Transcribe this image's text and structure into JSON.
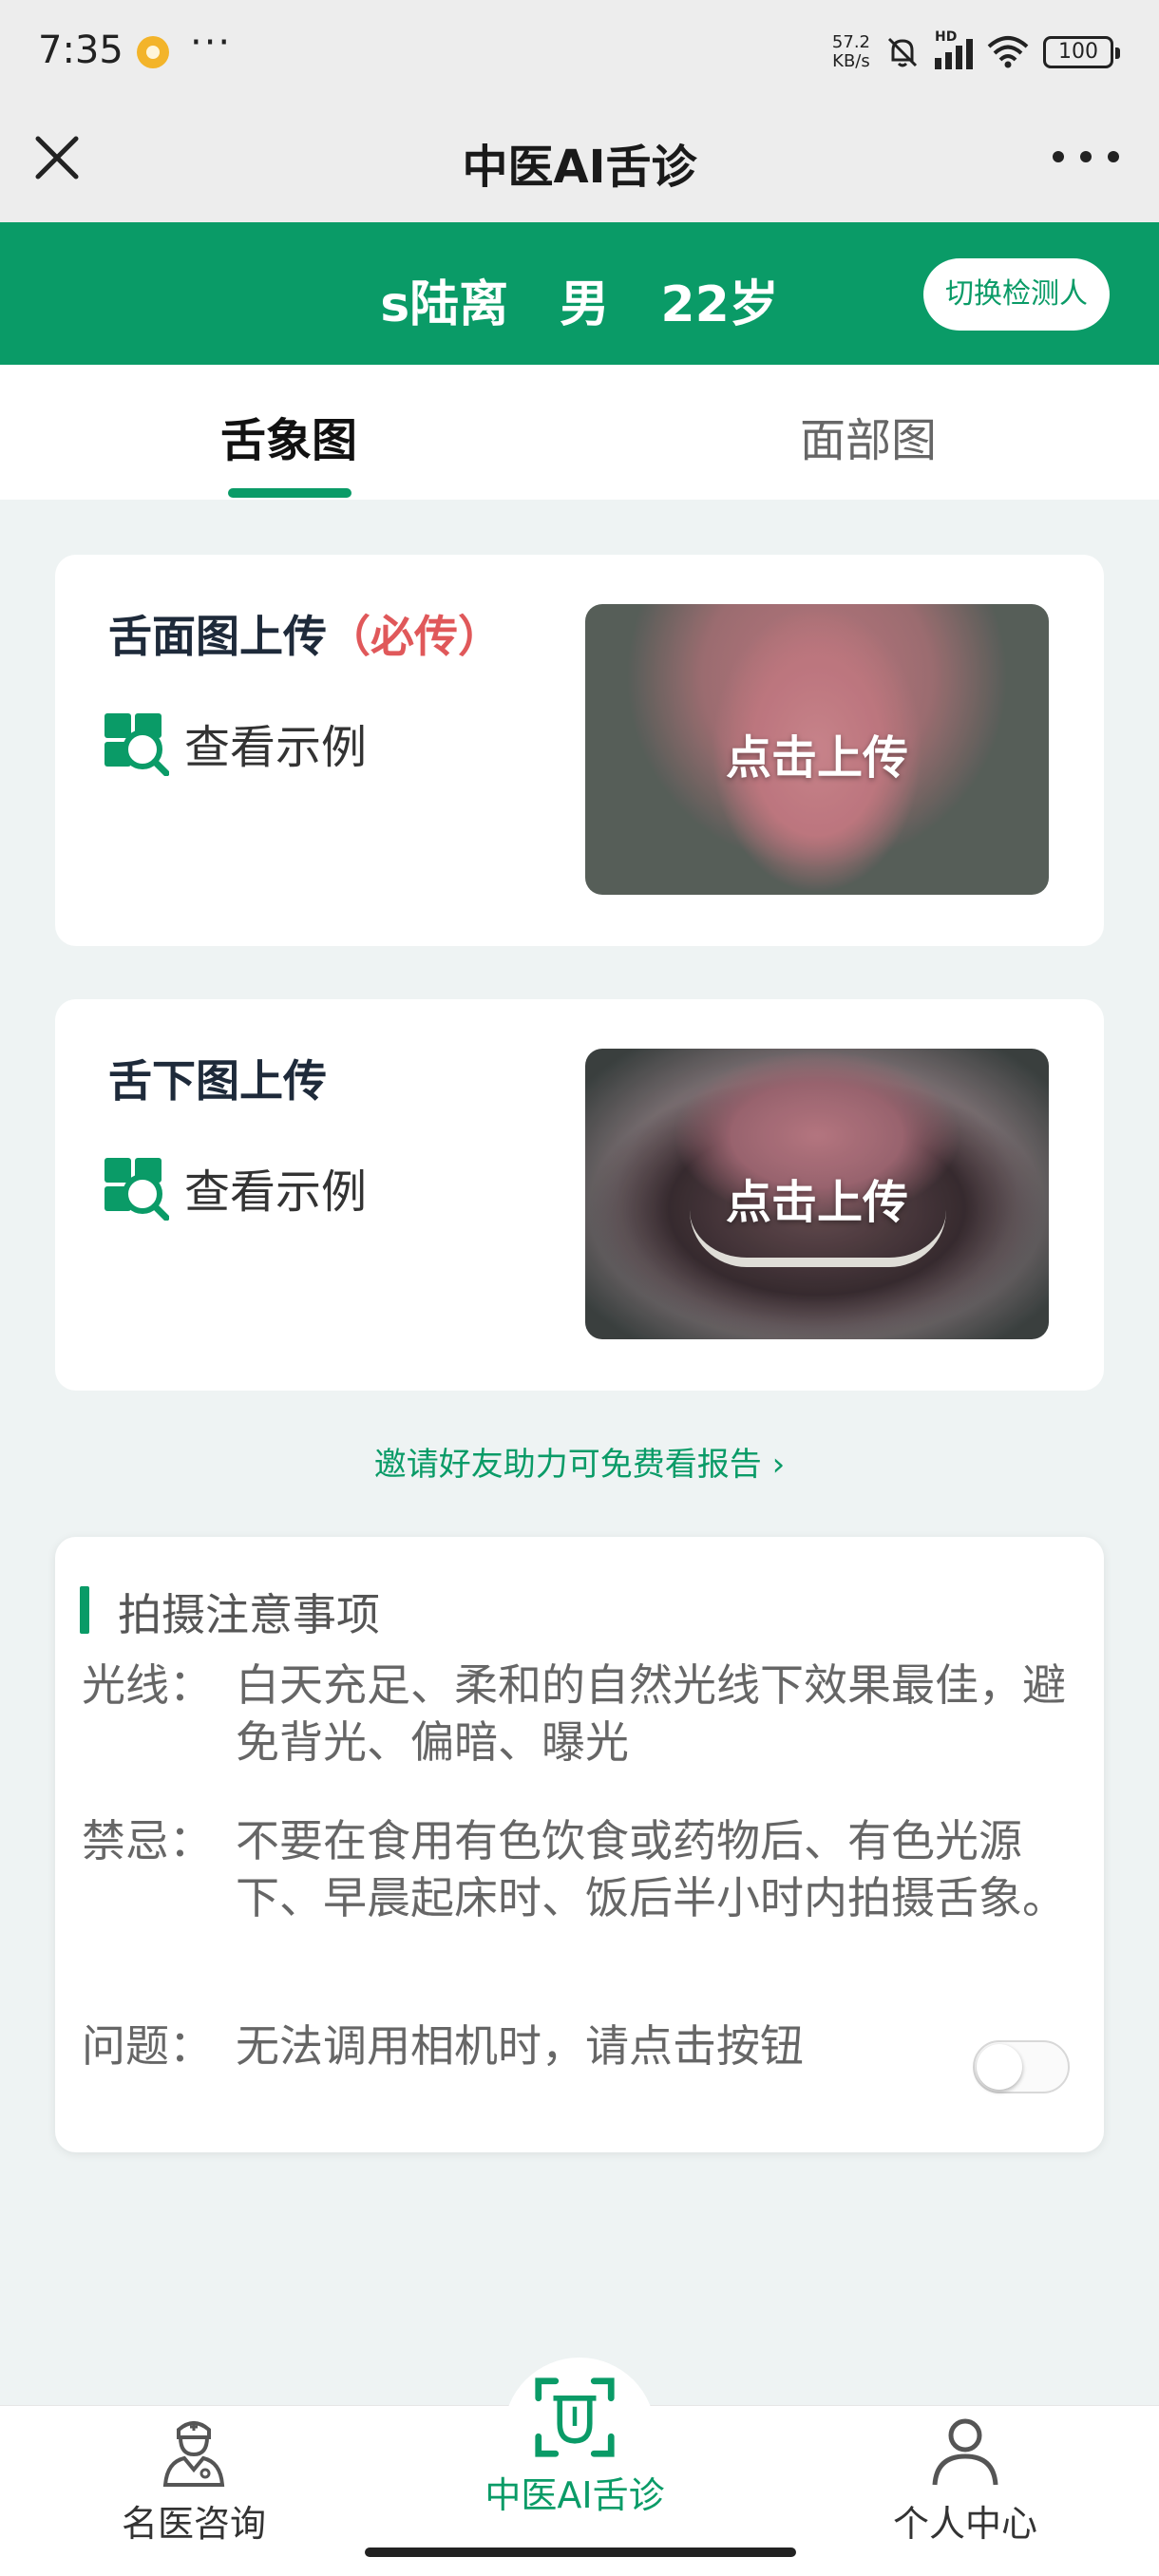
{
  "status_bar": {
    "time": "7:35",
    "network_speed_value": "57.2",
    "network_speed_unit": "KB/s",
    "signal_tag": "HD",
    "battery": "100"
  },
  "nav": {
    "title": "中医AI舌诊"
  },
  "patient": {
    "name": "s陆离",
    "gender": "男",
    "age": "22岁",
    "switch_label": "切换检测人"
  },
  "tabs": [
    {
      "label": "舌象图",
      "active": true
    },
    {
      "label": "面部图",
      "active": false
    }
  ],
  "cards": [
    {
      "title": "舌面图上传",
      "required_tag": "（必传）",
      "example_label": "查看示例",
      "upload_label": "点击上传"
    },
    {
      "title": "舌下图上传",
      "example_label": "查看示例",
      "upload_label": "点击上传"
    }
  ],
  "invite": {
    "text": "邀请好友助力可免费看报告 ›"
  },
  "notes": {
    "title": "拍摄注意事项",
    "rows": [
      {
        "label": "光线：",
        "text": "白天充足、柔和的自然光线下效果最佳，避免背光、偏暗、曝光"
      },
      {
        "label": "禁忌：",
        "text": "不要在食用有色饮食或药物后、有色光源下、早晨起床时、饭后半小时内拍摄舌象。"
      },
      {
        "label": "问题：",
        "text": "无法调用相机时，请点击按钮"
      }
    ],
    "toggle_on": false
  },
  "bottom_nav": [
    {
      "label": "名医咨询",
      "icon": "doctor-icon",
      "active": false
    },
    {
      "label": "中医AI舌诊",
      "icon": "tongue-scan-icon",
      "active": true
    },
    {
      "label": "个人中心",
      "icon": "person-icon",
      "active": false
    }
  ],
  "colors": {
    "brand_green": "#0a9b67",
    "required_red": "#e0585a",
    "page_bg": "#eef3f3"
  }
}
